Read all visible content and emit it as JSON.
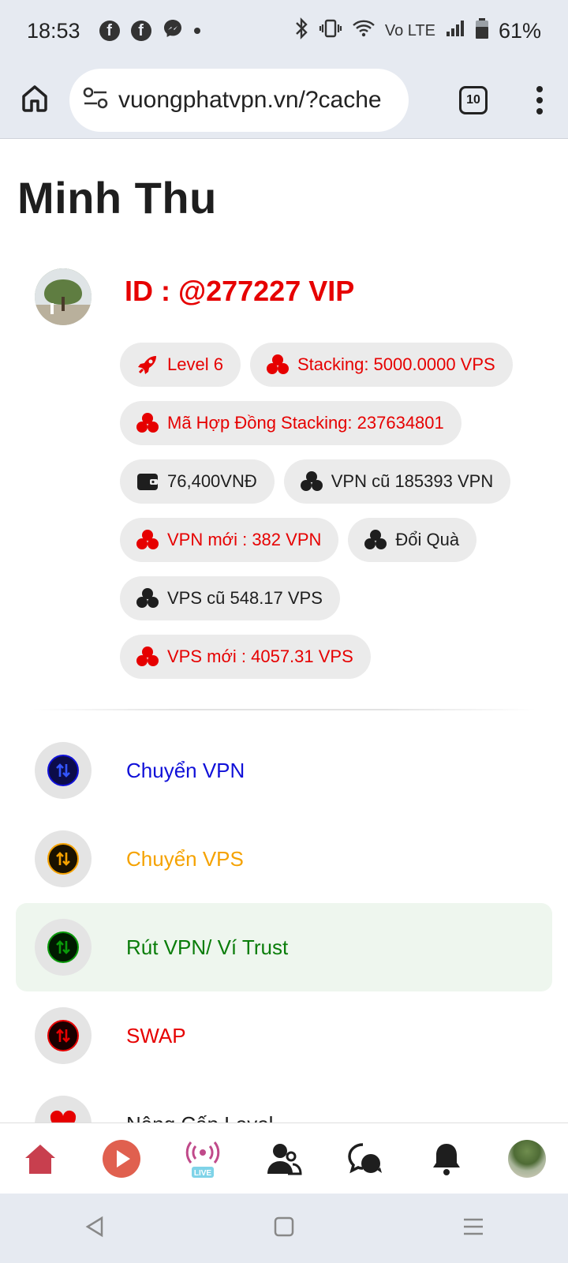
{
  "status_bar": {
    "time": "18:53",
    "left_icons": [
      "facebook-icon",
      "facebook-icon",
      "messenger-icon",
      "dot-icon"
    ],
    "right_icons": [
      "bluetooth-icon",
      "vibrate-icon",
      "wifi-icon",
      "volte-icon",
      "signal-icon",
      "battery-icon"
    ],
    "battery": "61%",
    "volte_label": "Vo LTE"
  },
  "browser": {
    "url": "vuongphatvpn.vn/?cache",
    "tab_count": "10"
  },
  "profile": {
    "name": "Minh Thu",
    "id_label": "ID : @277227 VIP"
  },
  "chips": [
    {
      "label": "Level 6",
      "color": "red",
      "icon": "rocket-icon"
    },
    {
      "label": "Stacking: 5000.0000 VPS",
      "color": "red",
      "icon": "coins-icon"
    },
    {
      "label": "Mã Hợp Đồng Stacking: 237634801",
      "color": "red",
      "icon": "coins-icon"
    },
    {
      "label": "76,400VNĐ",
      "color": "dark",
      "icon": "wallet-icon"
    },
    {
      "label": "VPN cũ 185393 VPN",
      "color": "dark",
      "icon": "coins-icon"
    },
    {
      "label": "VPN mới : 382 VPN",
      "color": "red",
      "icon": "coins-icon"
    },
    {
      "label": "Đổi Quà",
      "color": "dark",
      "icon": "coins-icon"
    },
    {
      "label": "VPS cũ 548.17 VPS",
      "color": "dark",
      "icon": "coins-icon"
    },
    {
      "label": "VPS mới : 4057.31 VPS",
      "color": "red",
      "icon": "coins-icon"
    }
  ],
  "menu": [
    {
      "label": "Chuyển VPN",
      "color": "#1010d8",
      "icon_color": "#1010d8",
      "active": false
    },
    {
      "label": "Chuyển VPS",
      "color": "#f5a200",
      "icon_color": "#f5a200",
      "active": false
    },
    {
      "label": "Rút VPN/ Ví Trust",
      "color": "#0a7d0a",
      "icon_color": "#0a9a0a",
      "active": true
    },
    {
      "label": "SWAP",
      "color": "#e60000",
      "icon_color": "#e60000",
      "active": false
    },
    {
      "label": "Nâng Cấp Level",
      "color": "#1e1e1e",
      "icon_color": "#e60000",
      "active": false
    }
  ],
  "bottom_nav": [
    {
      "name": "home-icon"
    },
    {
      "name": "play-icon"
    },
    {
      "name": "live-icon",
      "label": "LIVE"
    },
    {
      "name": "friends-icon"
    },
    {
      "name": "chat-icon"
    },
    {
      "name": "bell-icon"
    },
    {
      "name": "avatar"
    }
  ],
  "colors": {
    "accent_red": "#e60000",
    "chip_bg": "#ebebeb",
    "browser_bg": "#e6eaf1"
  }
}
